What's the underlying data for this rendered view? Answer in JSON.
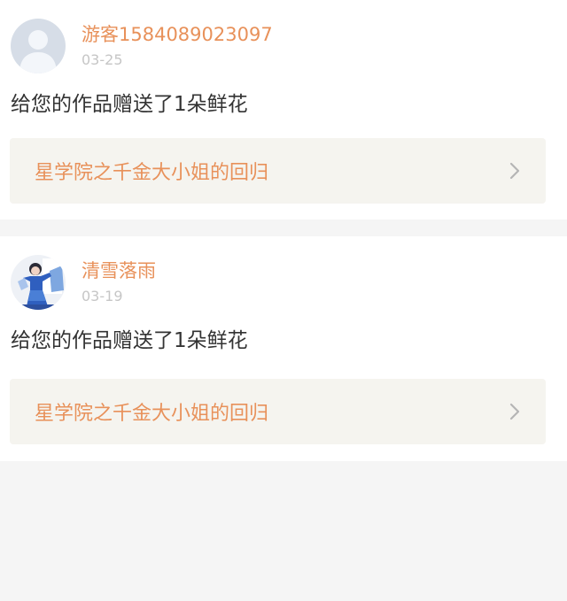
{
  "notifications": [
    {
      "username": "游客1584089023097",
      "date": "03-25",
      "message": "给您的作品赠送了1朵鲜花",
      "work_title": "星学院之千金大小姐的回归",
      "avatar_icon": "default-user-icon"
    },
    {
      "username": "清雪落雨",
      "date": "03-19",
      "message": "给您的作品赠送了1朵鲜花",
      "work_title": "星学院之千金大小姐的回归",
      "avatar_icon": "user-photo-avatar"
    }
  ],
  "colors": {
    "accent": "#e8915a",
    "date": "#c6c6c6",
    "text": "#333333",
    "link_bg": "#f5f4ef",
    "page_bg": "#f5f5f5"
  }
}
